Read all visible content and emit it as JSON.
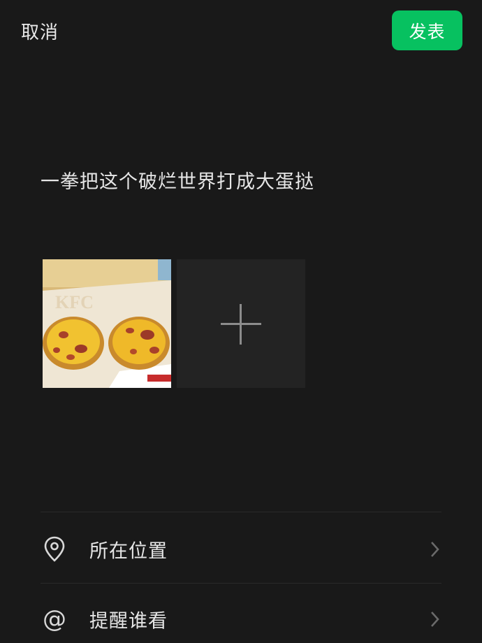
{
  "header": {
    "cancel_label": "取消",
    "publish_label": "发表"
  },
  "post": {
    "text": "一拳把这个破烂世界打成大蛋挞"
  },
  "photos": [
    {
      "description_icon": "photo-thumbnail"
    }
  ],
  "add_photo": {
    "icon": "plus-icon"
  },
  "options": [
    {
      "icon": "location-pin-icon",
      "label": "所在位置"
    },
    {
      "icon": "at-sign-icon",
      "label": "提醒谁看",
      "glyph": "@"
    }
  ],
  "colors": {
    "background": "#191919",
    "accent": "#07c160",
    "tile": "#232323",
    "divider": "#2a2a2a"
  }
}
